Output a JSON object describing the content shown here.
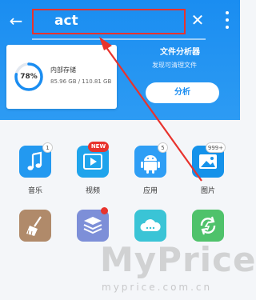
{
  "header": {
    "search_text": "act"
  },
  "storage": {
    "percent": "78%",
    "percent_value": 78,
    "title": "内部存储",
    "size": "85.96 GB / 110.81 GB"
  },
  "analyzer": {
    "title": "文件分析器",
    "subtitle": "发现可清理文件",
    "button_label": "分析"
  },
  "categories": [
    {
      "label": "音乐",
      "badge": "1",
      "icon": "music-note-icon"
    },
    {
      "label": "视频",
      "badge": "NEW",
      "icon": "video-play-icon"
    },
    {
      "label": "应用",
      "badge": "5",
      "icon": "android-icon"
    },
    {
      "label": "图片",
      "badge": "999+",
      "icon": "image-icon"
    }
  ],
  "tools": [
    {
      "icon": "broom-icon"
    },
    {
      "icon": "storage-layers-icon"
    },
    {
      "icon": "cloud-icon"
    },
    {
      "icon": "sync-icon"
    }
  ],
  "watermark": {
    "main": "MyPrice",
    "sub": "myprice.com.cn"
  },
  "colors": {
    "header_blue": "#1a8df1",
    "annotation_red": "#e8332d"
  }
}
